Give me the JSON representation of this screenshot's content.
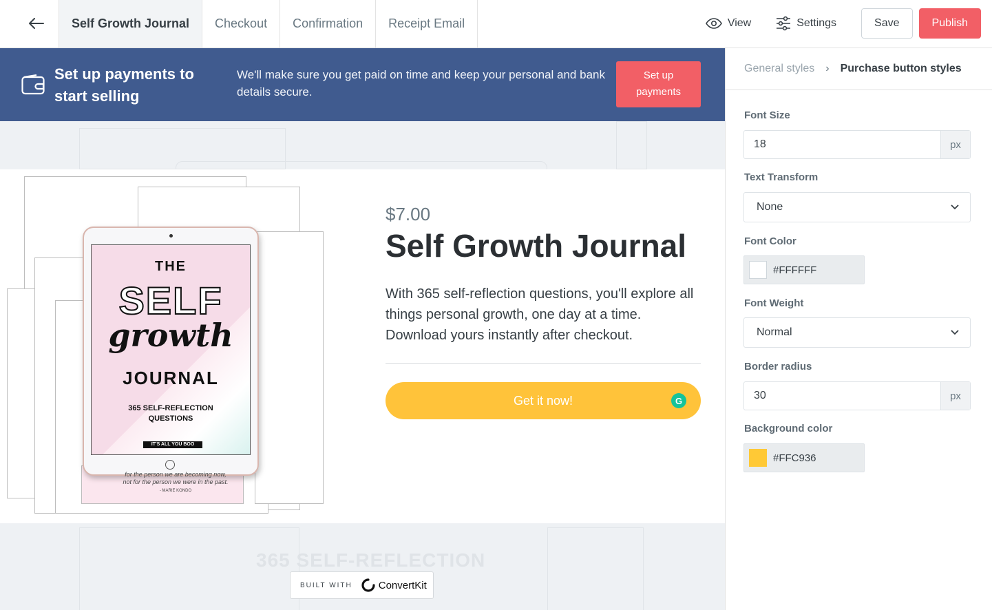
{
  "header": {
    "tabs": [
      {
        "label": "Self Growth Journal",
        "active": true
      },
      {
        "label": "Checkout",
        "active": false
      },
      {
        "label": "Confirmation",
        "active": false
      },
      {
        "label": "Receipt Email",
        "active": false
      }
    ],
    "view_label": "View",
    "settings_label": "Settings",
    "save_label": "Save",
    "publish_label": "Publish"
  },
  "banner": {
    "title": "Set up payments to start selling",
    "text": "We'll make sure you get paid on time and keep your personal and bank details secure.",
    "button_line1": "Set up",
    "button_line2": "payments"
  },
  "product": {
    "price": "$7.00",
    "title": "Self Growth Journal",
    "description": "With 365 self-reflection questions, you'll explore all things personal growth, one day at a time. Download yours instantly after checkout.",
    "button_label": "Get it now!",
    "cover": {
      "the": "THE",
      "self": "SELF",
      "growth": "growth",
      "journal": "JOURNAL",
      "subtitle_line1": "365 SELF-REFLECTION",
      "subtitle_line2": "QUESTIONS",
      "tag": "IT'S ALL YOU BOO",
      "quote_line1": "for the person we are becoming now,",
      "quote_line2": "not for the person we were in the past.",
      "quote_author": "- MARIE KONDO"
    }
  },
  "background_text": "365 SELF-REFLECTION",
  "badge": {
    "built_with": "BUILT WITH",
    "brand": "ConvertKit"
  },
  "panel": {
    "breadcrumb_parent": "General styles",
    "breadcrumb_sep": "›",
    "breadcrumb_current": "Purchase button styles",
    "font_size_label": "Font Size",
    "font_size_value": "18",
    "font_size_unit": "px",
    "text_transform_label": "Text Transform",
    "text_transform_value": "None",
    "font_color_label": "Font Color",
    "font_color_value": "#FFFFFF",
    "font_weight_label": "Font Weight",
    "font_weight_value": "Normal",
    "border_radius_label": "Border radius",
    "border_radius_value": "30",
    "border_radius_unit": "px",
    "bg_color_label": "Background color",
    "bg_color_value": "#FFC936"
  },
  "colors": {
    "banner_bg": "#405b8f",
    "accent_red": "#f25f66",
    "button_yellow": "#ffc33a"
  },
  "icons": [
    "back-arrow-icon",
    "eye-icon",
    "sliders-icon",
    "wallet-icon",
    "chevron-down-icon",
    "grammarly-icon",
    "convertkit-logo-icon"
  ]
}
